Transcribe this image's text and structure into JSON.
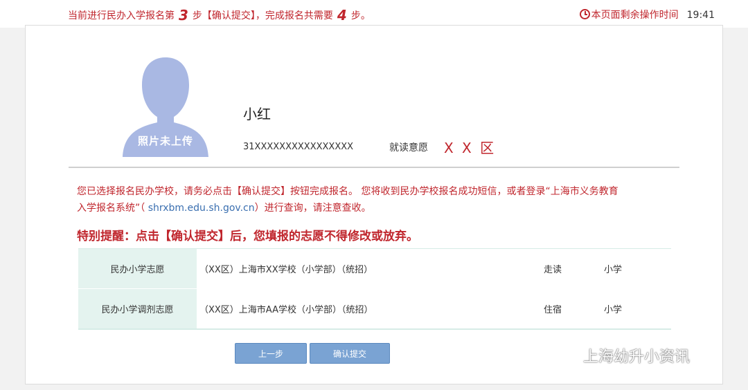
{
  "header": {
    "step_prefix": "当前进行民办入学报名第",
    "current_step": "3",
    "step_mid": "步【确认提交】，完成报名共需要",
    "total_steps": "4",
    "step_suffix": "步。",
    "timer_label": "本页面剩余操作时间",
    "timer_value": "19:41"
  },
  "student": {
    "photo_caption": "照片未上传",
    "name": "小红",
    "id_number": "31XXXXXXXXXXXXXXXX",
    "intent_label": "就读意愿",
    "intent_value": "X X 区"
  },
  "notice": {
    "line1": "您已选择报名民办学校，请务必点击【确认提交】按钮完成报名。 您将收到民办学校报名成功短信，或者登录“上海市义务教育",
    "line2_prefix": "入学报名系统”（ ",
    "site": "shrxbm.edu.sh.gov.cn",
    "line2_suffix": "）进行查询，请注意查收。",
    "warning": "特别提醒：点击【确认提交】后，您填报的志愿不得修改或放弃。"
  },
  "choices": [
    {
      "type": "民办小学志愿",
      "school": "（XX区）上海市XX学校（小学部）（统招）",
      "mode": "走读",
      "level": "小学"
    },
    {
      "type": "民办小学调剂志愿",
      "school": "（XX区）上海市AA学校（小学部）（统招）",
      "mode": "住宿",
      "level": "小学"
    }
  ],
  "buttons": {
    "prev": "上一步",
    "submit": "确认提交"
  },
  "watermark": {
    "text": "上海幼升小资讯",
    "icon": "wechat-icon"
  },
  "colors": {
    "accent_red": "#c0262d",
    "button_blue": "#7aa3d3",
    "table_label_bg": "#e4f3ef",
    "avatar_silhouette": "#a9b8e3"
  }
}
